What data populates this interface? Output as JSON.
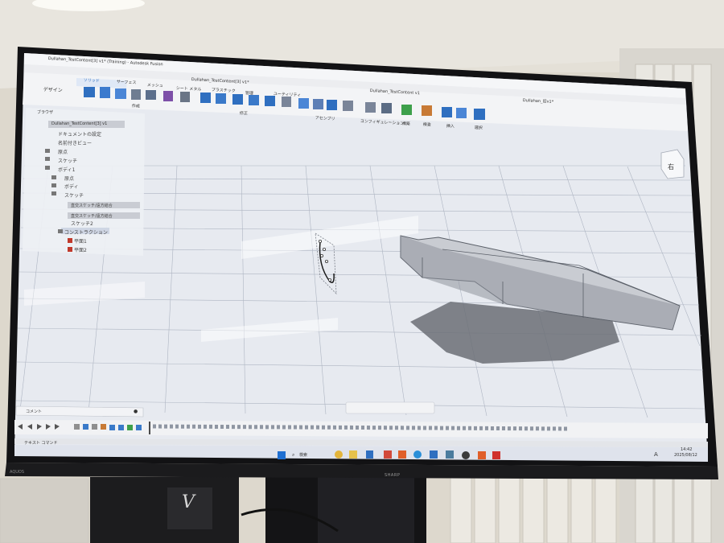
{
  "window": {
    "title": "Dullahan_TestContent[3] v1* (Training) - Autodesk Fusion",
    "tabs": [
      {
        "label": "Dullahan_TestContent[3] v1*"
      },
      {
        "label": "Dullahan_TestContent v1"
      },
      {
        "label": "Dullahan_旧v1*"
      }
    ]
  },
  "toolbar": {
    "workspace_label": "デザイン",
    "workspace_tabs": [
      "ソリッド",
      "サーフェス",
      "メッシュ",
      "シート メタル",
      "プラスチック",
      "管理",
      "ユーティリティ"
    ],
    "group_labels": [
      "作成",
      "修正",
      "アセンブリ",
      "コンフィギュレーション",
      "構築",
      "検査",
      "挿入",
      "選択"
    ]
  },
  "browser": {
    "title": "ブラウザ",
    "root": "Dullahan_TestContent[3] v1",
    "items": [
      "ドキュメントの設定",
      "名前付きビュー",
      "原点",
      "スケッチ",
      "ボディ1",
      "原点",
      "ボディ",
      "スケッチ",
      "直交スケッチ/遠方結合",
      "直交スケッチ/遠方結合",
      "スケッチ2",
      "コンストラクション",
      "平面1",
      "平面2"
    ]
  },
  "viewcube": {
    "face_label": "右"
  },
  "comment_panel": {
    "label": "コメント"
  },
  "text_command": {
    "label": "テキスト コマンド"
  },
  "taskbar": {
    "search_label": "検索",
    "time": "14:42",
    "date": "2025/08/12",
    "ime_label": "A"
  },
  "monitor": {
    "brand_left": "AQUOS",
    "brand_center": "SHARP"
  },
  "speaker": {
    "logo": "V"
  },
  "colors": {
    "toolbar_blue": "#2f6fc0",
    "viewport_bg": "#e6e9f0",
    "grid_line": "#aeb5c2",
    "body_shade": "#6f737a"
  }
}
